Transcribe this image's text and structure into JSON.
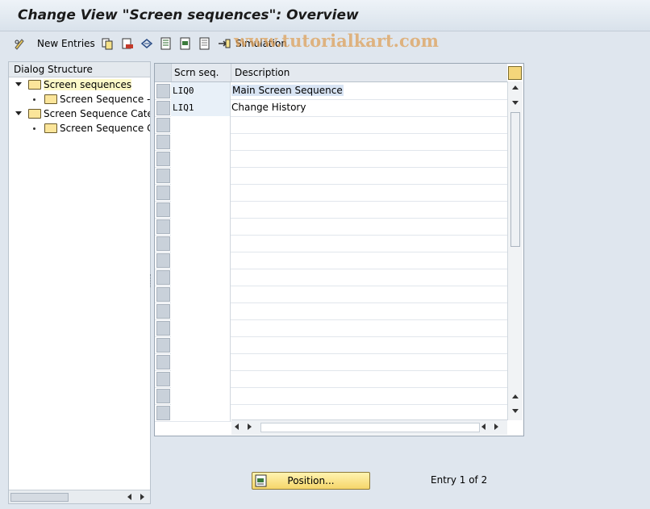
{
  "window": {
    "title": "Change View \"Screen sequences\": Overview"
  },
  "toolbar": {
    "new_entries": "New Entries",
    "simulation": "Simulation"
  },
  "watermark": "www.tutorialkart.com",
  "dialog_structure": {
    "header": "Dialog Structure",
    "items": [
      {
        "label": "Screen sequences",
        "level": 0,
        "expanded": true,
        "selected": true
      },
      {
        "label": "Screen Sequence ->",
        "level": 1,
        "expanded": false,
        "selected": false
      },
      {
        "label": "Screen Sequence Categ",
        "level": 0,
        "expanded": true,
        "selected": false
      },
      {
        "label": "Screen Sequence Ca",
        "level": 1,
        "expanded": false,
        "selected": false
      }
    ]
  },
  "table": {
    "columns": [
      "Scrn seq.",
      "Description"
    ],
    "rows": [
      {
        "seq": "LIQ0",
        "desc": "Main Screen Sequence"
      },
      {
        "seq": "LIQ1",
        "desc": "Change History"
      }
    ],
    "empty_rows": 18
  },
  "footer": {
    "position_label": "Position...",
    "entry_text": "Entry 1 of 2"
  },
  "colors": {
    "selected_tree": "#fcf8c8",
    "button": "#f5d66a",
    "background": "#dfe6ee"
  }
}
